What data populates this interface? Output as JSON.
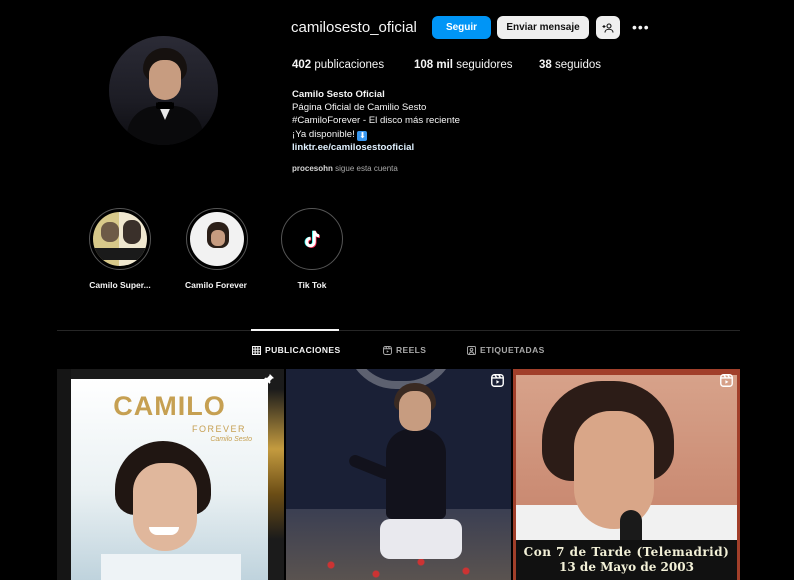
{
  "profile": {
    "username": "camilosesto_oficial",
    "follow_label": "Seguir",
    "message_label": "Enviar mensaje",
    "stats": {
      "posts_count": "402",
      "posts_label": "publicaciones",
      "followers_count": "108 mil",
      "followers_label": "seguidores",
      "following_count": "38",
      "following_label": "seguidos"
    },
    "bio": {
      "name": "Camilo Sesto Oficial",
      "line1": "Página Oficial de Camilio Sesto",
      "line2": "#CamiloForever - El disco más reciente",
      "line3": "¡Ya disponible!",
      "emoji": "⬇",
      "link": "linktr.ee/camilosestooficial"
    },
    "followed_by_user": "procesohn",
    "followed_by_text": "sigue esta cuenta"
  },
  "highlights": [
    {
      "label": "Camilo Super..."
    },
    {
      "label": "Camilo Forever"
    },
    {
      "label": "Tik Tok"
    }
  ],
  "tabs": {
    "posts": "PUBLICACIONES",
    "reels": "REELS",
    "tagged": "ETIQUETADAS"
  },
  "posts": {
    "post1": {
      "title": "CAMILO",
      "subtitle": "FOREVER",
      "script": "Camilo Sesto"
    },
    "post3": {
      "caption_line1": "Con 7 de Tarde (Telemadrid)",
      "caption_line2": "13 de Mayo de 2003"
    }
  },
  "colors": {
    "background": "#000000",
    "accent": "#0095f6",
    "button_light": "#efefef",
    "text_secondary": "#a8a8a8"
  },
  "icons": [
    "add-person-icon",
    "more-icon",
    "tiktok-icon",
    "grid-icon",
    "reels-icon",
    "tagged-icon",
    "pin-icon",
    "reel-badge-icon"
  ]
}
